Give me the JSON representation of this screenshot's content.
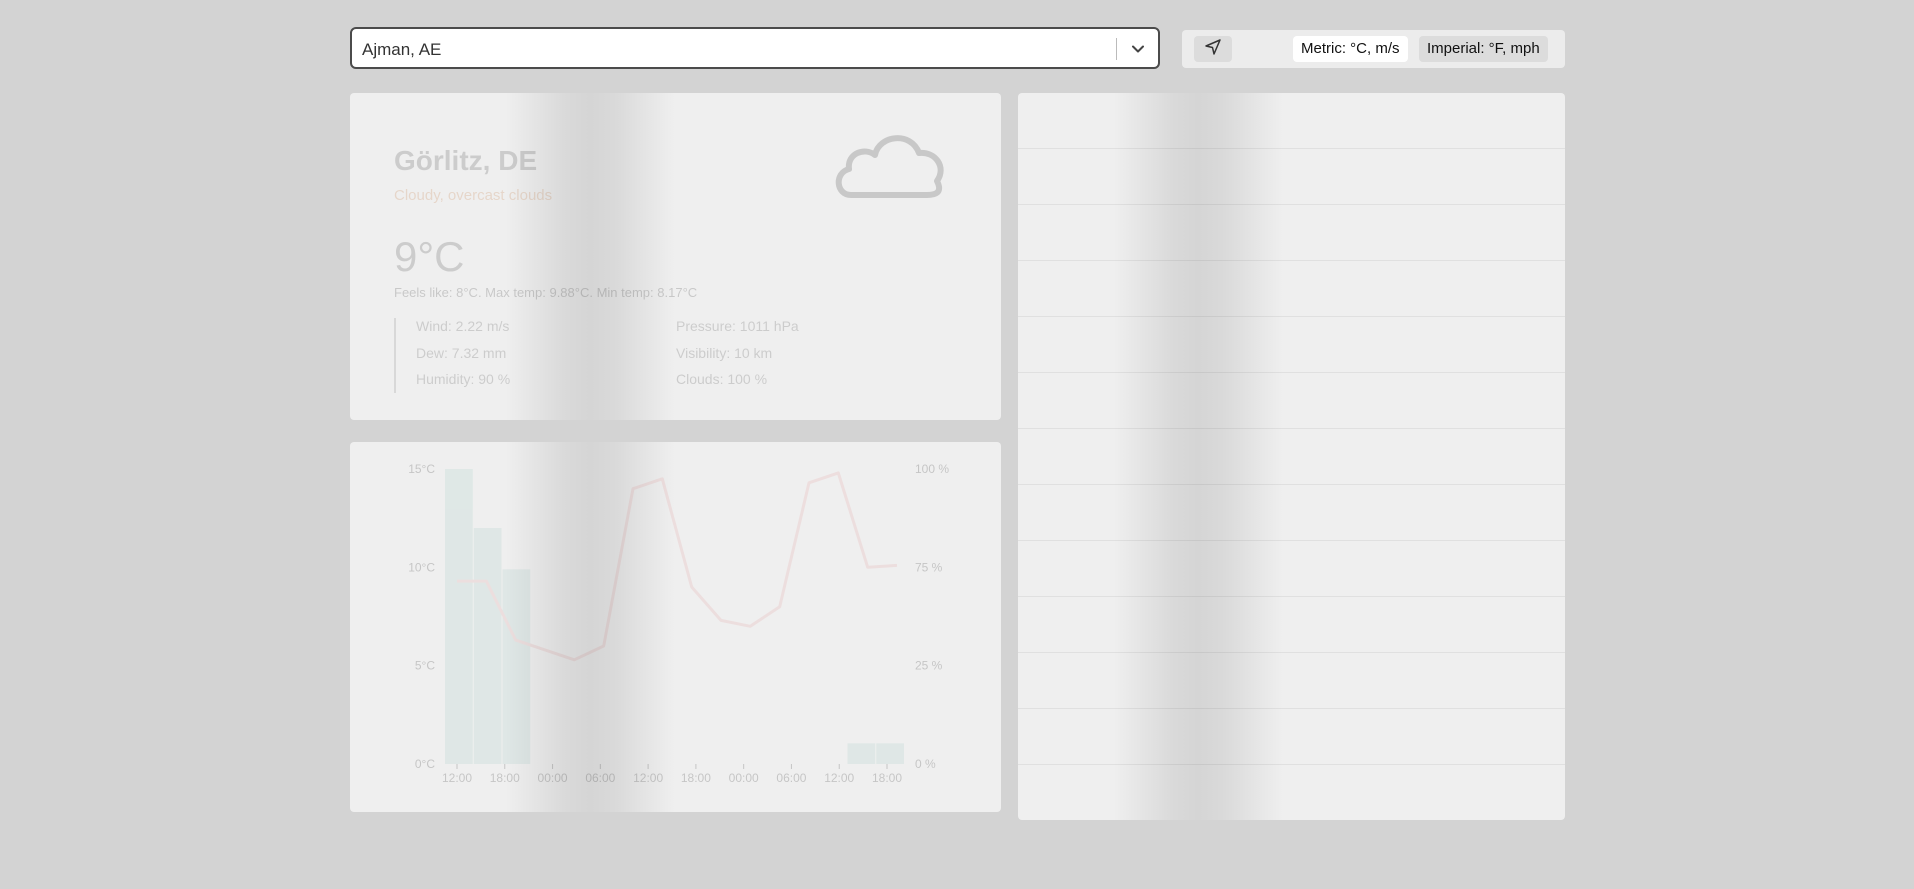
{
  "search": {
    "value": "Ajman, AE"
  },
  "toolbar": {
    "location_icon": "location-arrow-icon",
    "metric_label": "Metric: °C, m/s",
    "imperial_label": "Imperial: °F, mph",
    "selected": "metric"
  },
  "current": {
    "city": "Görlitz, DE",
    "description": "Cloudy, overcast clouds",
    "temperature": "9°C",
    "feels_line": "Feels like: 8°C. Max temp: 9.88°C. Min temp: 8.17°C",
    "details": [
      "Wind: 2.22 m/s",
      "Pressure: 1011 hPa",
      "Dew: 7.32 mm",
      "Visibility: 10 km",
      "Humidity: 90 %",
      "Clouds: 100 %"
    ],
    "icon": "cloud-icon"
  },
  "chart_data": {
    "type": "line",
    "x": [
      "12:00",
      "18:00",
      "00:00",
      "06:00",
      "12:00",
      "18:00",
      "00:00",
      "06:00",
      "12:00",
      "18:00"
    ],
    "left_axis_ticks": [
      "15°C",
      "10°C",
      "5°C",
      "0°C"
    ],
    "right_axis_ticks": [
      "100 %",
      "75 %",
      "25 %",
      "0 %"
    ],
    "series": [
      {
        "values": [
          9.3,
          9.3,
          6.3,
          5.8,
          5.3,
          6.0,
          14.0,
          14.5,
          9.0,
          7.3,
          7.0,
          8.0,
          14.3,
          14.8,
          10.0,
          10.1
        ]
      }
    ],
    "bars": [
      100,
      80,
      66,
      0,
      0,
      0,
      0,
      0,
      0,
      0,
      0,
      0,
      0,
      0,
      7,
      7
    ],
    "ylim": [
      0,
      15
    ]
  },
  "colors": {
    "background": "#d3d3d3",
    "panel": "#efefef",
    "line": "#e6a4a4",
    "bar": "#a9cfc9",
    "accent_desc": "#c8804a"
  }
}
